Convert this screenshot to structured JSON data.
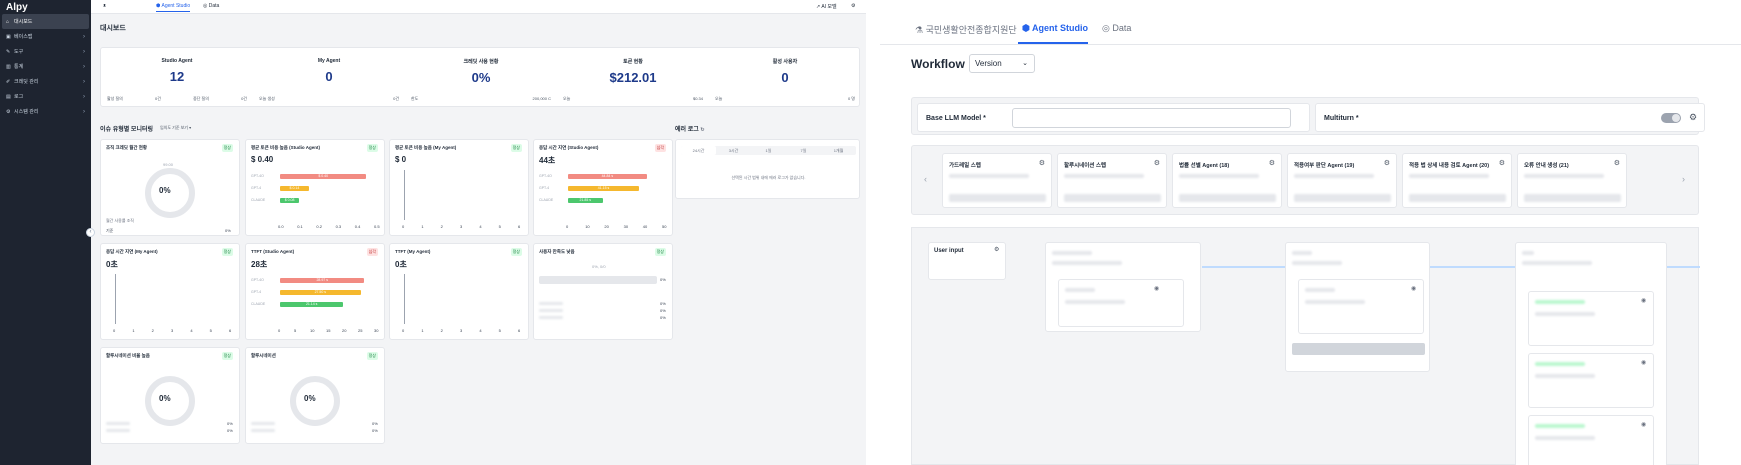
{
  "left": {
    "app_name": "Alpy",
    "sidebar": {
      "items": [
        {
          "icon": "home-icon",
          "glyph": "⌂",
          "label": "대시보드",
          "active": true,
          "chevron": false
        },
        {
          "icon": "database-icon",
          "glyph": "▣",
          "label": "베이스맵",
          "active": false,
          "chevron": true
        },
        {
          "icon": "tool-icon",
          "glyph": "✎",
          "label": "도구",
          "active": false,
          "chevron": true
        },
        {
          "icon": "chart-icon",
          "glyph": "▥",
          "label": "통계",
          "active": false,
          "chevron": true
        },
        {
          "icon": "brush-icon",
          "glyph": "✐",
          "label": "크레딧 관리",
          "active": false,
          "chevron": true
        },
        {
          "icon": "log-icon",
          "glyph": "▤",
          "label": "로그",
          "active": false,
          "chevron": true
        },
        {
          "icon": "settings-icon",
          "glyph": "⚙",
          "label": "시스템 관리",
          "active": false,
          "chevron": true
        }
      ]
    },
    "topbar": {
      "tab_first": "ᴥ",
      "tab_studio": "Agent Studio",
      "tab_data": "Data",
      "ai_model": "AI 모델"
    },
    "dashboard_title": "대시보드",
    "kpis": [
      {
        "label": "Studio Agent",
        "value": "12",
        "subs": [
          [
            "활성 질의",
            "0건"
          ],
          [
            "중단 질의",
            "0건"
          ]
        ]
      },
      {
        "label": "My Agent",
        "value": "0",
        "subs": [
          [
            "오늘 생성",
            "0건"
          ]
        ]
      },
      {
        "label": "크레딧 사용 현황",
        "value": "0%",
        "subs": [
          [
            "한도",
            "200,000 C"
          ]
        ]
      },
      {
        "label": "토큰 현황",
        "value": "$212.01",
        "subs": [
          [
            "오늘",
            "$0.34"
          ]
        ]
      },
      {
        "label": "활성 사용자",
        "value": "0",
        "subs": [
          [
            "오늘",
            "0 명"
          ]
        ]
      }
    ],
    "monitoring_title": "이슈 유형별 모니터링",
    "monitoring_select": "임의도 기준 보기 ▾",
    "error_log_title": "에러 로그",
    "error_log_tabs": [
      "24시간",
      "3시간",
      "1일",
      "7일",
      "1개월"
    ],
    "error_log_empty": "선택된 시간 범위 내에 에러 로그가 없습니다.",
    "cards": {
      "c1": {
        "title": "조직 크레딧 월간 현황",
        "badge": "정상",
        "gauge_value": "0%",
        "gauge_top": "99.00",
        "note": "월간 사용률 조직",
        "foot_left": "기준",
        "foot_right": "0%"
      },
      "c2": {
        "title": "평균 토큰 비용 높음 (Studio Agent)",
        "badge": "정상",
        "value": "$ 0.40",
        "bars": [
          [
            "$ 0.40",
            0.9,
            "#f28b82",
            "GPT-4O"
          ],
          [
            "$ 0.14",
            0.3,
            "#f5b82e",
            "GPT-4"
          ],
          [
            "$ 0.08",
            0.2,
            "#4cc76d",
            "CLAUDE"
          ]
        ],
        "ticks": [
          "0.0",
          "0.1",
          "0.2",
          "0.3",
          "0.4",
          "0.5"
        ]
      },
      "c3": {
        "title": "평균 토큰 비용 높음 (My Agent)",
        "badge": "정상",
        "value": "$ 0",
        "ticks": [
          "0",
          "1",
          "2",
          "3",
          "4",
          "5",
          "6"
        ]
      },
      "c4": {
        "title": "응답 시간 지연 (Studio Agent)",
        "badge": "심각",
        "value": "44초",
        "bars": [
          [
            "44.84 s",
            0.82,
            "#f28b82",
            "GPT-4O"
          ],
          [
            "41.15 s",
            0.74,
            "#f5b82e",
            "GPT-4"
          ],
          [
            "21.85 s",
            0.36,
            "#4cc76d",
            "CLAUDE"
          ]
        ],
        "ticks": [
          "0",
          "10",
          "20",
          "30",
          "40",
          "50"
        ]
      },
      "c5": {
        "title": "응답 시간 지연 (My Agent)",
        "badge": "정상",
        "value": "0초",
        "ticks": [
          "0",
          "1",
          "2",
          "3",
          "4",
          "5",
          "6"
        ]
      },
      "c6": {
        "title": "TTFT (Studio Agent)",
        "badge": "심각",
        "value": "28초",
        "bars": [
          [
            "28.97 s",
            0.88,
            "#f28b82",
            "GPT-4O"
          ],
          [
            "27.50 s",
            0.84,
            "#f5b82e",
            "GPT-4"
          ],
          [
            "21.14 s",
            0.66,
            "#4cc76d",
            "CLAUDE"
          ]
        ],
        "ticks": [
          "0",
          "5",
          "10",
          "15",
          "20",
          "25",
          "30"
        ]
      },
      "c7": {
        "title": "TTFT (My Agent)",
        "badge": "정상",
        "value": "0초",
        "ticks": [
          "0",
          "1",
          "2",
          "3",
          "4",
          "5",
          "6"
        ]
      },
      "c8": {
        "title": "사용자 만족도 낮음",
        "badge": "정상",
        "top": "0%, 0/0",
        "pct": "0%",
        "rows": [
          [
            "0%"
          ],
          [
            "0%"
          ],
          [
            "0%"
          ]
        ]
      },
      "c9": {
        "title": "할루시네이션 비율 높음",
        "badge": "정상",
        "gauge_value": "0%",
        "rows": [
          [
            "0%"
          ],
          [
            "0%"
          ]
        ]
      },
      "c10": {
        "title": "할루시네이션",
        "badge": "정상",
        "gauge_value": "0%",
        "rows": [
          [
            "0%"
          ],
          [
            "0%"
          ]
        ]
      }
    }
  },
  "right": {
    "tabs": [
      "국민생활안전종합지원단",
      "Agent Studio",
      "Data"
    ],
    "workflow_title": "Workflow",
    "version_label": "Version",
    "base_llm_label": "Base LLM Model *",
    "multiturn_label": "Multiturn *",
    "agents": [
      {
        "name": "가드레일 스텝"
      },
      {
        "name": "할루시네이션 스텝"
      },
      {
        "name": "법률 선별 Agent (18)"
      },
      {
        "name": "적용여부 판단 Agent (19)"
      },
      {
        "name": "적용 법 상세 내용 검토 Agent (20)"
      },
      {
        "name": "오류 안내 생성 (21)"
      }
    ],
    "user_input_label": "User input"
  },
  "colors": {
    "accent": "#2563eb",
    "sidebar_bg": "#1e2430",
    "kpi_value": "#1e3a8a"
  }
}
